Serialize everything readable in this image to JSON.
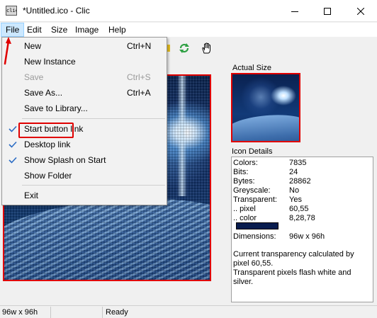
{
  "window": {
    "title": "*Untitled.ico - Clic",
    "app_icon_text": "clic"
  },
  "menubar": [
    "File",
    "Edit",
    "Size",
    "Image",
    "Help"
  ],
  "file_menu": {
    "items": [
      {
        "label": "New",
        "shortcut": "Ctrl+N",
        "enabled": true,
        "checked": false
      },
      {
        "label": "New Instance",
        "shortcut": "",
        "enabled": true,
        "checked": false
      },
      {
        "label": "Save",
        "shortcut": "Ctrl+S",
        "enabled": false,
        "checked": false
      },
      {
        "label": "Save As...",
        "shortcut": "Ctrl+A",
        "enabled": true,
        "checked": false
      },
      {
        "label": "Save to Library...",
        "shortcut": "",
        "enabled": true,
        "checked": false
      },
      {
        "label": "Start button link",
        "shortcut": "",
        "enabled": true,
        "checked": true
      },
      {
        "label": "Desktop link",
        "shortcut": "",
        "enabled": true,
        "checked": true
      },
      {
        "label": "Show Splash on Start",
        "shortcut": "",
        "enabled": true,
        "checked": true
      },
      {
        "label": "Show Folder",
        "shortcut": "",
        "enabled": true,
        "checked": false
      },
      {
        "label": "Exit",
        "shortcut": "",
        "enabled": true,
        "checked": false
      }
    ]
  },
  "preview": {
    "actual_size_label": "Actual Size"
  },
  "details": {
    "label": "Icon Details",
    "rows": [
      {
        "key": "Colors:",
        "value": "7835"
      },
      {
        "key": "Bits:",
        "value": "24"
      },
      {
        "key": "Bytes:",
        "value": "28862"
      },
      {
        "key": "Greyscale:",
        "value": "No"
      },
      {
        "key": "Transparent:",
        "value": "Yes"
      },
      {
        "key": ".. pixel",
        "value": "60,55"
      },
      {
        "key": ".. color",
        "value": "8,28,78"
      },
      {
        "key": "Dimensions:",
        "value": "96w x 96h"
      }
    ],
    "swatch_color": "#081c4e",
    "note": "Current transparency calculated by pixel 60,55.\nTransparent pixels flash white and silver."
  },
  "statusbar": {
    "size": "96w x 96h",
    "middle": "",
    "status": "Ready"
  },
  "colors": {
    "annotation_red": "#e00000",
    "menu_highlight": "#cce8ff",
    "check_blue": "#2b6cc4"
  }
}
